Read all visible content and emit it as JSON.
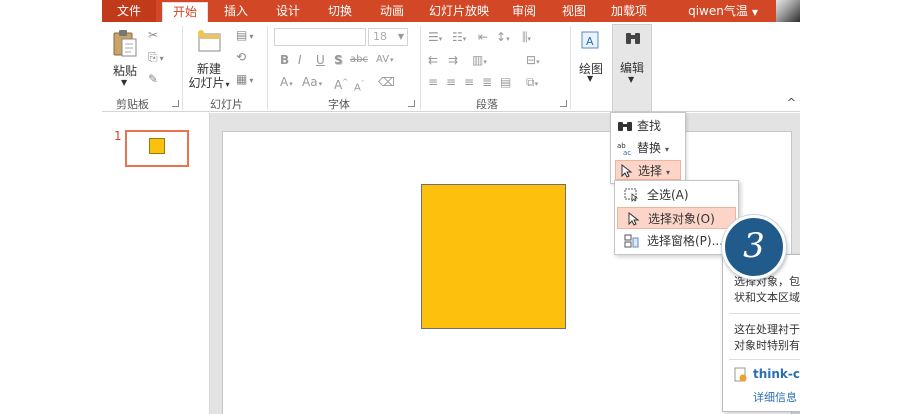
{
  "tabs": {
    "file": "文件",
    "home": "开始",
    "insert": "插入",
    "design": "设计",
    "transitions": "切换",
    "animations": "动画",
    "slideshow": "幻灯片放映",
    "review": "审阅",
    "view": "视图",
    "addins": "加载项"
  },
  "user": {
    "name": "qiwen气温"
  },
  "ribbon": {
    "clipboard": {
      "paste": "粘贴",
      "label": "剪贴板"
    },
    "slides": {
      "new_slide_line1": "新建",
      "new_slide_line2": "幻灯片",
      "label": "幻灯片"
    },
    "font": {
      "size": "18",
      "label": "字体",
      "bold": "B",
      "italic": "I",
      "underline": "U",
      "shadow": "S",
      "strike": "abc",
      "spacing": "AV",
      "font_color": "A",
      "change_case": "Aa",
      "grow": "A",
      "shrink": "A"
    },
    "paragraph": {
      "label": "段落"
    },
    "drawing": {
      "label": "绘图"
    },
    "editing": {
      "label": "编辑"
    }
  },
  "slides_pane": {
    "number": "1"
  },
  "editing_menu": {
    "find": "查找",
    "replace": "替换",
    "select": "选择"
  },
  "select_submenu": {
    "select_all": "全选(A)",
    "select_objects": "选择对象(O)",
    "selection_pane": "选择窗格(P)..."
  },
  "tooltip": {
    "line1": "选择对象，包",
    "line2": "状和文本区域",
    "line3": "这在处理衬于",
    "line4": "对象时特别有",
    "link": "think-ce",
    "more": "详细信息"
  },
  "step_badge": "3",
  "colors": {
    "accent": "#d24726",
    "shape_fill": "#fdc00c",
    "hover": "#fcd5c8",
    "badge": "#215b8c"
  }
}
